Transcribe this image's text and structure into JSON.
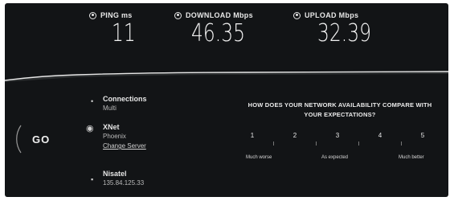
{
  "metrics": {
    "ping": {
      "label": "PING ms",
      "value": "11"
    },
    "download": {
      "label": "DOWNLOAD Mbps",
      "value": "46.35"
    },
    "upload": {
      "label": "UPLOAD Mbps",
      "value": "32.39"
    }
  },
  "go_label": "GO",
  "connections": {
    "title": "Connections",
    "value": "Multi"
  },
  "host": {
    "name": "XNet",
    "location": "Phoenix",
    "change_server": "Change Server"
  },
  "provider": {
    "name": "Nisatel",
    "ip": "135.84.125.33"
  },
  "survey": {
    "question": "HOW DOES YOUR NETWORK AVAILABILITY COMPARE WITH YOUR EXPECTATIONS?",
    "options": [
      "1",
      "2",
      "3",
      "4",
      "5"
    ],
    "scale_low": "Much worse",
    "scale_mid": "As expected",
    "scale_high": "Much better"
  },
  "colors": {
    "background": "#121416",
    "text": "#e8e8e8",
    "graph_line": "#e6e6e6"
  },
  "icons": {
    "ping": "ping-icon",
    "download": "download-icon",
    "upload": "upload-icon",
    "connections": "connections-icon",
    "host": "host-icon",
    "provider": "user-icon"
  }
}
